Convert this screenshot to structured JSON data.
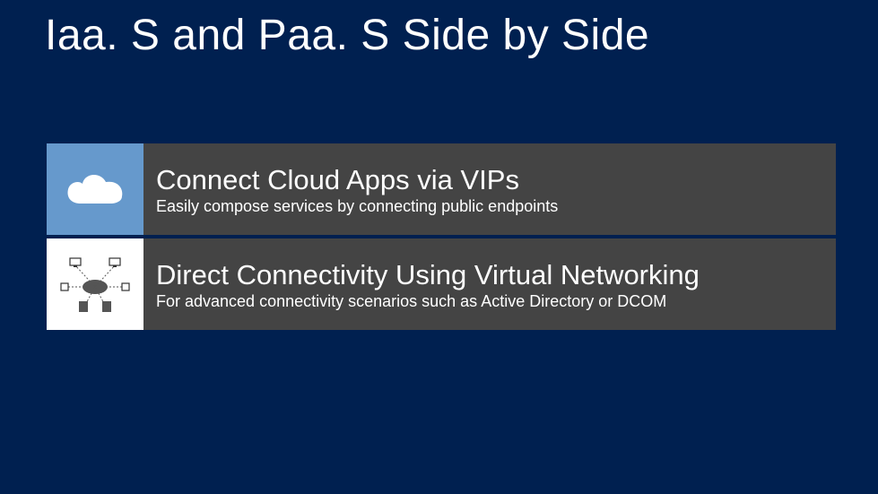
{
  "title": "Iaa. S and Paa. S Side by Side",
  "rows": [
    {
      "icon": "cloud-icon",
      "icon_bg": "blue",
      "heading": "Connect Cloud Apps via VIPs",
      "sub": "Easily compose services by connecting public endpoints"
    },
    {
      "icon": "network-icon",
      "icon_bg": "white",
      "heading": "Direct Connectivity Using Virtual Networking",
      "sub": "For advanced connectivity scenarios such as Active Directory or DCOM"
    }
  ]
}
